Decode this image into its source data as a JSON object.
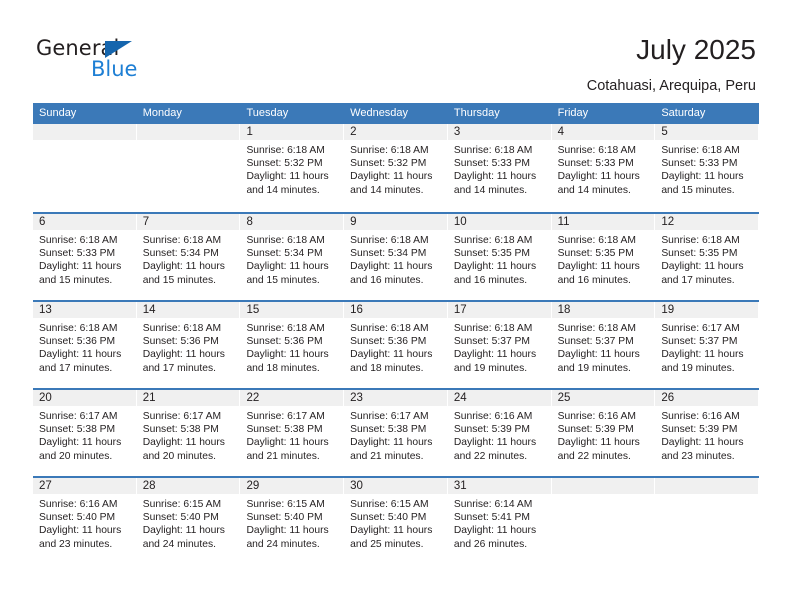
{
  "brand": {
    "name_dark": "General",
    "name_blue": "Blue",
    "accent_color": "#1565ad",
    "blue_color": "#1e7fd4"
  },
  "header": {
    "title": "July 2025",
    "subtitle": "Cotahuasi, Arequipa, Peru"
  },
  "theme": {
    "header_band": "#3b79b8",
    "daynum_band": "#f0f0f0",
    "text": "#231f20"
  },
  "weekdays": [
    "Sunday",
    "Monday",
    "Tuesday",
    "Wednesday",
    "Thursday",
    "Friday",
    "Saturday"
  ],
  "weeks": [
    [
      {
        "day": "",
        "empty": true
      },
      {
        "day": "",
        "empty": true
      },
      {
        "day": "1",
        "sunrise": "Sunrise: 6:18 AM",
        "sunset": "Sunset: 5:32 PM",
        "daylight": "Daylight: 11 hours and 14 minutes."
      },
      {
        "day": "2",
        "sunrise": "Sunrise: 6:18 AM",
        "sunset": "Sunset: 5:32 PM",
        "daylight": "Daylight: 11 hours and 14 minutes."
      },
      {
        "day": "3",
        "sunrise": "Sunrise: 6:18 AM",
        "sunset": "Sunset: 5:33 PM",
        "daylight": "Daylight: 11 hours and 14 minutes."
      },
      {
        "day": "4",
        "sunrise": "Sunrise: 6:18 AM",
        "sunset": "Sunset: 5:33 PM",
        "daylight": "Daylight: 11 hours and 14 minutes."
      },
      {
        "day": "5",
        "sunrise": "Sunrise: 6:18 AM",
        "sunset": "Sunset: 5:33 PM",
        "daylight": "Daylight: 11 hours and 15 minutes."
      }
    ],
    [
      {
        "day": "6",
        "sunrise": "Sunrise: 6:18 AM",
        "sunset": "Sunset: 5:33 PM",
        "daylight": "Daylight: 11 hours and 15 minutes."
      },
      {
        "day": "7",
        "sunrise": "Sunrise: 6:18 AM",
        "sunset": "Sunset: 5:34 PM",
        "daylight": "Daylight: 11 hours and 15 minutes."
      },
      {
        "day": "8",
        "sunrise": "Sunrise: 6:18 AM",
        "sunset": "Sunset: 5:34 PM",
        "daylight": "Daylight: 11 hours and 15 minutes."
      },
      {
        "day": "9",
        "sunrise": "Sunrise: 6:18 AM",
        "sunset": "Sunset: 5:34 PM",
        "daylight": "Daylight: 11 hours and 16 minutes."
      },
      {
        "day": "10",
        "sunrise": "Sunrise: 6:18 AM",
        "sunset": "Sunset: 5:35 PM",
        "daylight": "Daylight: 11 hours and 16 minutes."
      },
      {
        "day": "11",
        "sunrise": "Sunrise: 6:18 AM",
        "sunset": "Sunset: 5:35 PM",
        "daylight": "Daylight: 11 hours and 16 minutes."
      },
      {
        "day": "12",
        "sunrise": "Sunrise: 6:18 AM",
        "sunset": "Sunset: 5:35 PM",
        "daylight": "Daylight: 11 hours and 17 minutes."
      }
    ],
    [
      {
        "day": "13",
        "sunrise": "Sunrise: 6:18 AM",
        "sunset": "Sunset: 5:36 PM",
        "daylight": "Daylight: 11 hours and 17 minutes."
      },
      {
        "day": "14",
        "sunrise": "Sunrise: 6:18 AM",
        "sunset": "Sunset: 5:36 PM",
        "daylight": "Daylight: 11 hours and 17 minutes."
      },
      {
        "day": "15",
        "sunrise": "Sunrise: 6:18 AM",
        "sunset": "Sunset: 5:36 PM",
        "daylight": "Daylight: 11 hours and 18 minutes."
      },
      {
        "day": "16",
        "sunrise": "Sunrise: 6:18 AM",
        "sunset": "Sunset: 5:36 PM",
        "daylight": "Daylight: 11 hours and 18 minutes."
      },
      {
        "day": "17",
        "sunrise": "Sunrise: 6:18 AM",
        "sunset": "Sunset: 5:37 PM",
        "daylight": "Daylight: 11 hours and 19 minutes."
      },
      {
        "day": "18",
        "sunrise": "Sunrise: 6:18 AM",
        "sunset": "Sunset: 5:37 PM",
        "daylight": "Daylight: 11 hours and 19 minutes."
      },
      {
        "day": "19",
        "sunrise": "Sunrise: 6:17 AM",
        "sunset": "Sunset: 5:37 PM",
        "daylight": "Daylight: 11 hours and 19 minutes."
      }
    ],
    [
      {
        "day": "20",
        "sunrise": "Sunrise: 6:17 AM",
        "sunset": "Sunset: 5:38 PM",
        "daylight": "Daylight: 11 hours and 20 minutes."
      },
      {
        "day": "21",
        "sunrise": "Sunrise: 6:17 AM",
        "sunset": "Sunset: 5:38 PM",
        "daylight": "Daylight: 11 hours and 20 minutes."
      },
      {
        "day": "22",
        "sunrise": "Sunrise: 6:17 AM",
        "sunset": "Sunset: 5:38 PM",
        "daylight": "Daylight: 11 hours and 21 minutes."
      },
      {
        "day": "23",
        "sunrise": "Sunrise: 6:17 AM",
        "sunset": "Sunset: 5:38 PM",
        "daylight": "Daylight: 11 hours and 21 minutes."
      },
      {
        "day": "24",
        "sunrise": "Sunrise: 6:16 AM",
        "sunset": "Sunset: 5:39 PM",
        "daylight": "Daylight: 11 hours and 22 minutes."
      },
      {
        "day": "25",
        "sunrise": "Sunrise: 6:16 AM",
        "sunset": "Sunset: 5:39 PM",
        "daylight": "Daylight: 11 hours and 22 minutes."
      },
      {
        "day": "26",
        "sunrise": "Sunrise: 6:16 AM",
        "sunset": "Sunset: 5:39 PM",
        "daylight": "Daylight: 11 hours and 23 minutes."
      }
    ],
    [
      {
        "day": "27",
        "sunrise": "Sunrise: 6:16 AM",
        "sunset": "Sunset: 5:40 PM",
        "daylight": "Daylight: 11 hours and 23 minutes."
      },
      {
        "day": "28",
        "sunrise": "Sunrise: 6:15 AM",
        "sunset": "Sunset: 5:40 PM",
        "daylight": "Daylight: 11 hours and 24 minutes."
      },
      {
        "day": "29",
        "sunrise": "Sunrise: 6:15 AM",
        "sunset": "Sunset: 5:40 PM",
        "daylight": "Daylight: 11 hours and 24 minutes."
      },
      {
        "day": "30",
        "sunrise": "Sunrise: 6:15 AM",
        "sunset": "Sunset: 5:40 PM",
        "daylight": "Daylight: 11 hours and 25 minutes."
      },
      {
        "day": "31",
        "sunrise": "Sunrise: 6:14 AM",
        "sunset": "Sunset: 5:41 PM",
        "daylight": "Daylight: 11 hours and 26 minutes."
      },
      {
        "day": "",
        "empty": true
      },
      {
        "day": "",
        "empty": true
      }
    ]
  ]
}
